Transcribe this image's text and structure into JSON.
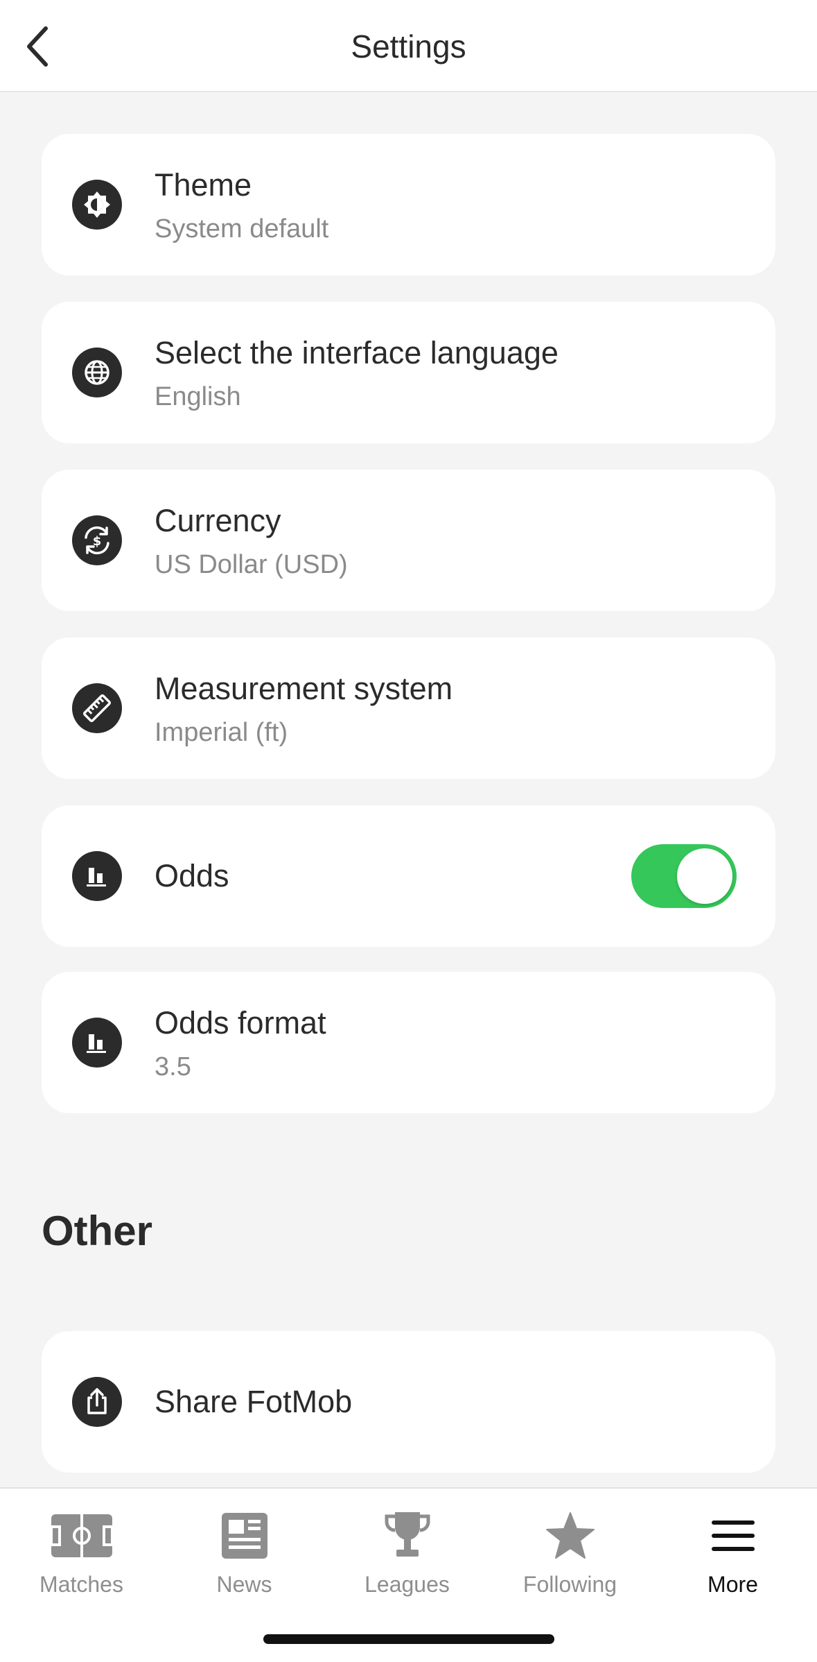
{
  "header": {
    "title": "Settings"
  },
  "settings": [
    {
      "title": "Theme",
      "value": "System default",
      "icon": "theme-icon"
    },
    {
      "title": "Select the interface language",
      "value": "English",
      "icon": "globe-icon"
    },
    {
      "title": "Currency",
      "value": "US Dollar (USD)",
      "icon": "currency-exchange-icon"
    },
    {
      "title": "Measurement system",
      "value": "Imperial (ft)",
      "icon": "ruler-icon"
    },
    {
      "title": "Odds",
      "toggle_on": true,
      "icon": "odds-chart-icon"
    },
    {
      "title": "Odds format",
      "value": "3.5",
      "icon": "odds-chart-icon"
    }
  ],
  "other": {
    "heading": "Other",
    "items": [
      {
        "title": "Share FotMob",
        "icon": "share-icon"
      }
    ]
  },
  "tabbar": {
    "tabs": [
      {
        "label": "Matches",
        "icon": "pitch-icon",
        "active": false
      },
      {
        "label": "News",
        "icon": "newspaper-icon",
        "active": false
      },
      {
        "label": "Leagues",
        "icon": "trophy-icon",
        "active": false
      },
      {
        "label": "Following",
        "icon": "star-icon",
        "active": false
      },
      {
        "label": "More",
        "icon": "menu-icon",
        "active": true
      }
    ]
  },
  "colors": {
    "toggle_on": "#35c759",
    "icon_bg": "#2b2b2b",
    "tab_inactive": "#8e8e8e",
    "tab_active": "#111111"
  }
}
